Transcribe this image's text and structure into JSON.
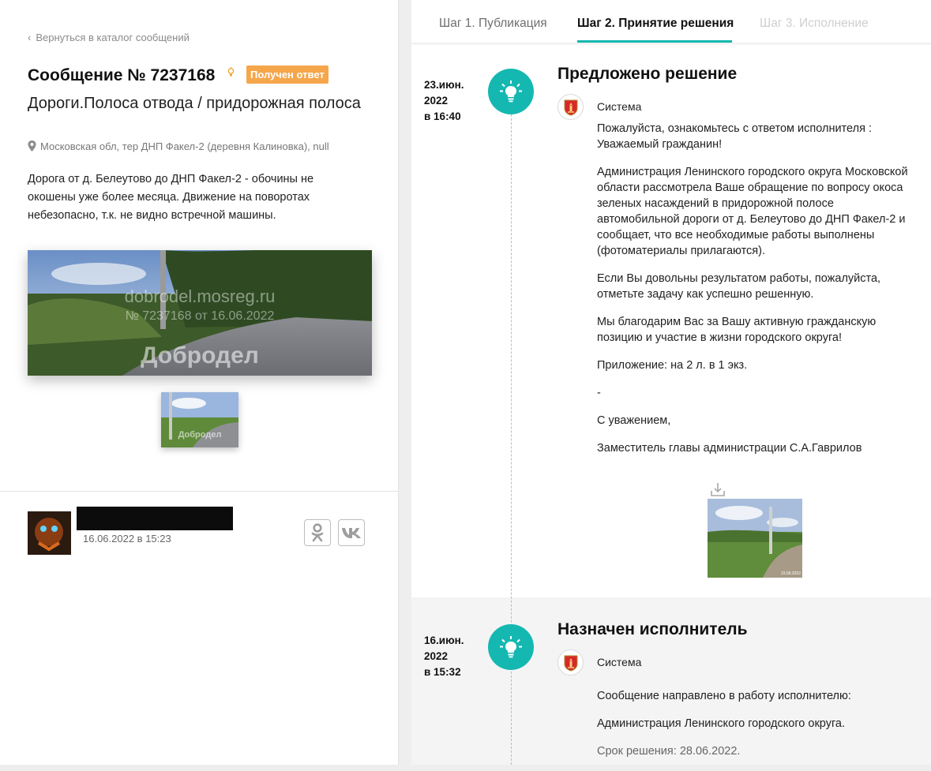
{
  "left": {
    "back_link": "Вернуться в каталог сообщений",
    "message_title": "Сообщение № 7237168",
    "status_badge": "Получен ответ",
    "category": "Дороги.Полоса отвода / придорожная полоса",
    "address": "Московская обл, тер ДНП Факел-2 (деревня Калиновка), null",
    "description": "Дорога от д. Белеутово до ДНП Факел-2 - обочины не окошены уже более месяца. Движение на поворотах небезопасно, т.к. не видно встречной машины.",
    "photo_watermark": {
      "site": "dobrodel.mosreg.ru",
      "number": "№ 7237168 от 16.06.2022",
      "brand": "Добродел"
    },
    "thumb_watermark": "Добродел",
    "author_date": "16.06.2022 в 15:23",
    "share_icons": [
      "odnoklassniki-icon",
      "vk-icon"
    ]
  },
  "tabs": [
    {
      "label": "Шаг 1. Публикация",
      "state": "done"
    },
    {
      "label": "Шаг 2. Принятие решения",
      "state": "active"
    },
    {
      "label": "Шаг 3. Исполнение",
      "state": "disabled"
    }
  ],
  "colors": {
    "accent": "#14b8b1",
    "badge": "#f5a64b",
    "disabled_tab": "#cfcfcf"
  },
  "events": [
    {
      "date": [
        "23.июн.",
        "2022",
        "в 16:40"
      ],
      "title": "Предложено решение",
      "author": "Система",
      "icon": "lightbulb-icon",
      "paragraphs": [
        "Пожалуйста, ознакомьтесь с ответом исполнителя : Уважаемый гражданин!",
        "Администрация Ленинского городского округа Московской области рассмотрела Ваше обращение по вопросу окоса зеленых насаждений в придорожной полосе автомобильной дороги от д. Белеутово до ДНП Факел-2 и сообщает, что все необходимые работы выполнены (фотоматериалы прилагаются).",
        "Если Вы довольны результатом работы, пожалуйста, отметьте задачу как успешно решенную.",
        "Мы благодарим Вас за Вашу активную гражданскую позицию и участие в жизни городского округа!",
        "Приложение: на 2 л. в 1 экз.",
        "-",
        "С уважением,",
        "Заместитель главы администрации С.А.Гаврилов"
      ],
      "photo_caption": "23.06.2022"
    },
    {
      "date": [
        "16.июн.",
        "2022",
        "в 15:32"
      ],
      "title": "Назначен исполнитель",
      "author": "Система",
      "icon": "lightbulb-icon",
      "paragraphs": [
        "Сообщение направлено в работу исполнителю:",
        "Администрация Ленинского городского округа."
      ],
      "deadline": "Срок решения: 28.06.2022."
    }
  ]
}
